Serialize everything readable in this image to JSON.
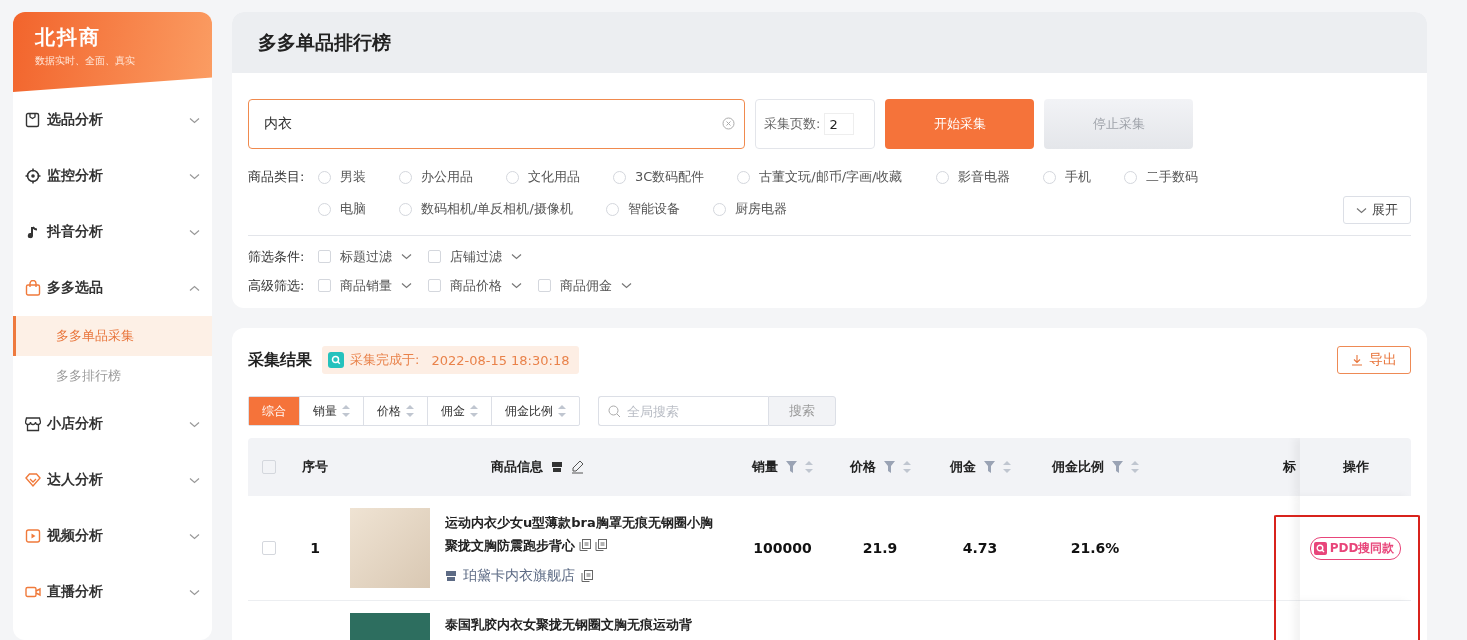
{
  "sidebar": {
    "brand": "北抖商",
    "tagline": "数据实时、全面、真实",
    "items": [
      {
        "label": "选品分析",
        "expanded": false
      },
      {
        "label": "监控分析",
        "expanded": false
      },
      {
        "label": "抖音分析",
        "expanded": false
      },
      {
        "label": "多多选品",
        "expanded": true,
        "children": [
          {
            "label": "多多单品采集",
            "selected": true
          },
          {
            "label": "多多排行榜",
            "selected": false
          }
        ]
      },
      {
        "label": "小店分析",
        "expanded": false
      },
      {
        "label": "达人分析",
        "expanded": false
      },
      {
        "label": "视频分析",
        "expanded": false
      },
      {
        "label": "直播分析",
        "expanded": false
      }
    ]
  },
  "page_title": "多多单品排行榜",
  "search": {
    "value": "内衣"
  },
  "page_count": {
    "label": "采集页数:",
    "value": "2"
  },
  "buttons": [
    {
      "label": "开始采集",
      "kind": "primary",
      "disabled": false
    },
    {
      "label": "停止采集",
      "kind": "secondary",
      "disabled": true
    }
  ],
  "categories": {
    "label": "商品类目:",
    "expand_button": "展开",
    "options": [
      {
        "label": "男装",
        "selected": false
      },
      {
        "label": "办公用品",
        "selected": false
      },
      {
        "label": "文化用品",
        "selected": false
      },
      {
        "label": "3C数码配件",
        "selected": false
      },
      {
        "label": "古董文玩/邮币/字画/收藏",
        "selected": false
      },
      {
        "label": "影音电器",
        "selected": false
      },
      {
        "label": "手机",
        "selected": false
      },
      {
        "label": "二手数码",
        "selected": false
      },
      {
        "label": "电脑",
        "selected": false
      },
      {
        "label": "数码相机/单反相机/摄像机",
        "selected": false
      },
      {
        "label": "智能设备",
        "selected": false
      },
      {
        "label": "厨房电器",
        "selected": false
      }
    ]
  },
  "filters": [
    {
      "label": "筛选条件:",
      "options": [
        {
          "label": "标题过滤",
          "checked": false
        },
        {
          "label": "店铺过滤",
          "checked": false
        }
      ]
    },
    {
      "label": "高级筛选:",
      "options": [
        {
          "label": "商品销量",
          "checked": false
        },
        {
          "label": "商品价格",
          "checked": false
        },
        {
          "label": "商品佣金",
          "checked": false
        }
      ]
    }
  ],
  "results": {
    "title": "采集结果",
    "status": {
      "label": "采集完成于:",
      "time": "2022-08-15 18:30:18"
    },
    "export_button": "导出",
    "sort_tabs": [
      {
        "label": "综合",
        "selected": true,
        "sortable": false
      },
      {
        "label": "销量",
        "selected": false,
        "sortable": true
      },
      {
        "label": "价格",
        "selected": false,
        "sortable": true
      },
      {
        "label": "佣金",
        "selected": false,
        "sortable": true
      },
      {
        "label": "佣金比例",
        "selected": false,
        "sortable": true
      }
    ],
    "global_search": {
      "placeholder": "全局搜索",
      "button": "搜索"
    },
    "table": {
      "header_checked": false,
      "action_column_highlighted": true,
      "columns": [
        {
          "label": "序号",
          "kind": "plain"
        },
        {
          "label": "商品信息",
          "kind": "product"
        },
        {
          "label": "销量",
          "kind": "metric"
        },
        {
          "label": "价格",
          "kind": "metric"
        },
        {
          "label": "佣金",
          "kind": "metric"
        },
        {
          "label": "佣金比例",
          "kind": "metric"
        },
        {
          "label": "标",
          "kind": "plain"
        },
        {
          "label": "操作",
          "kind": "plain"
        }
      ],
      "rows": [
        {
          "selected": false,
          "index": "1",
          "title": "运动内衣少女u型薄款bra胸罩无痕无钢圈小胸聚拢文胸防震跑步背心",
          "shop": "珀黛卡内衣旗舰店",
          "sales": "100000",
          "price": "21.9",
          "commission": "4.73",
          "ratio": "21.6%",
          "action": "PDD搜同款"
        },
        {
          "title": "泰国乳胶内衣女聚拢无钢圈文胸无痕运动背"
        }
      ]
    }
  }
}
